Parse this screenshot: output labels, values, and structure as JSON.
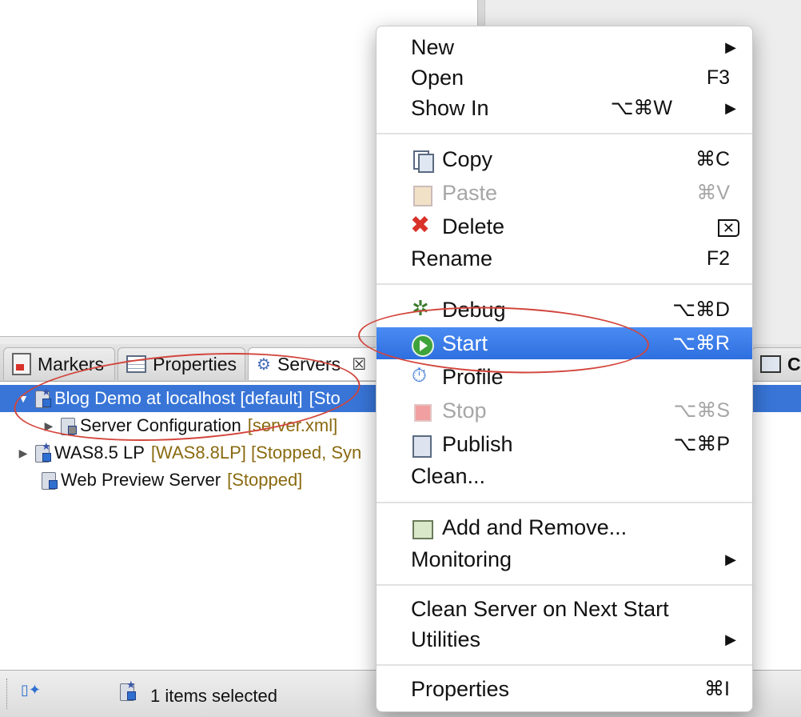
{
  "tabs": {
    "markers": "Markers",
    "properties": "Properties",
    "servers": "Servers",
    "c": "C"
  },
  "servers": [
    {
      "name": "Blog Demo at localhost [default]",
      "meta": "[Sto",
      "expanded": true,
      "selected": true
    },
    {
      "name": "Server Configuration",
      "meta": "[server.xml]",
      "child": true
    },
    {
      "name": "WAS8.5 LP",
      "meta": "[WAS8.8LP]  [Stopped, Syn",
      "expanded": false
    },
    {
      "name": "Web Preview Server",
      "meta": "[Stopped]"
    }
  ],
  "status": {
    "text": "1 items selected"
  },
  "menu": {
    "new": {
      "label": "New"
    },
    "open": {
      "label": "Open",
      "shortcut": "F3"
    },
    "show_in": {
      "label": "Show In",
      "shortcut": "⌥⌘W"
    },
    "copy": {
      "label": "Copy",
      "shortcut": "⌘C"
    },
    "paste": {
      "label": "Paste",
      "shortcut": "⌘V"
    },
    "delete": {
      "label": "Delete",
      "shortcut": "⌦"
    },
    "rename": {
      "label": "Rename",
      "shortcut": "F2"
    },
    "debug": {
      "label": "Debug",
      "shortcut": "⌥⌘D"
    },
    "start": {
      "label": "Start",
      "shortcut": "⌥⌘R"
    },
    "profile": {
      "label": "Profile"
    },
    "stop": {
      "label": "Stop",
      "shortcut": "⌥⌘S"
    },
    "publish": {
      "label": "Publish",
      "shortcut": "⌥⌘P"
    },
    "clean": {
      "label": "Clean..."
    },
    "add_remove": {
      "label": "Add and Remove..."
    },
    "monitoring": {
      "label": "Monitoring"
    },
    "clean_next_start": {
      "label": "Clean Server on Next Start"
    },
    "utilities": {
      "label": "Utilities"
    },
    "properties": {
      "label": "Properties",
      "shortcut": "⌘I"
    }
  },
  "colors": {
    "selection": "#3875d7",
    "menu_highlight": "#2e6fe0",
    "annotation": "#d2453c"
  }
}
